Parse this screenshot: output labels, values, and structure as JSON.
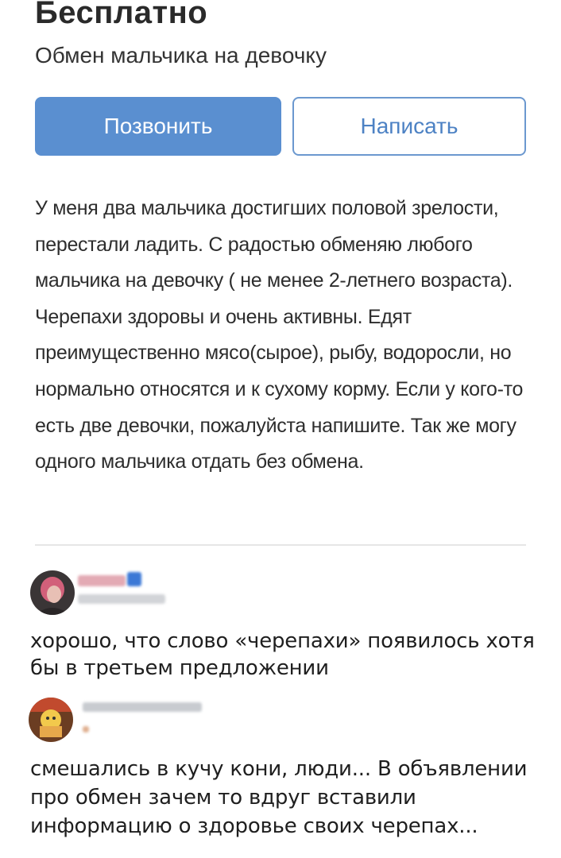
{
  "listing": {
    "price": "Бесплатно",
    "title": "Обмен мальчика на девочку",
    "call_label": "Позвонить",
    "write_label": "Написать",
    "description": "У меня два мальчика достигших половой зрелости, перестали ладить. С радостью обменяю любого мальчика на девочку ( не менее 2-летнего возраста). Черепахи здоровы и очень активны. Едят преимущественно мясо(сырое), рыбу, водоросли, но нормально относятся и к сухому корму. Если у кого-то есть две девочки, пожалуйста напишите. Так же могу одного мальчика отдать без обмена."
  },
  "comments": [
    {
      "text": "хорошо, что слово «черепахи» появилось хотя бы в третьем предложении"
    },
    {
      "text": "смешались в кучу кони, люди... В объявлении про обмен зачем то вдруг вставили информацию о здоровье своих черепах..."
    }
  ],
  "colors": {
    "call_button_bg": "#5a8fd0",
    "write_button_text": "#4d82c4",
    "verified_badge": "#3b78d6"
  }
}
